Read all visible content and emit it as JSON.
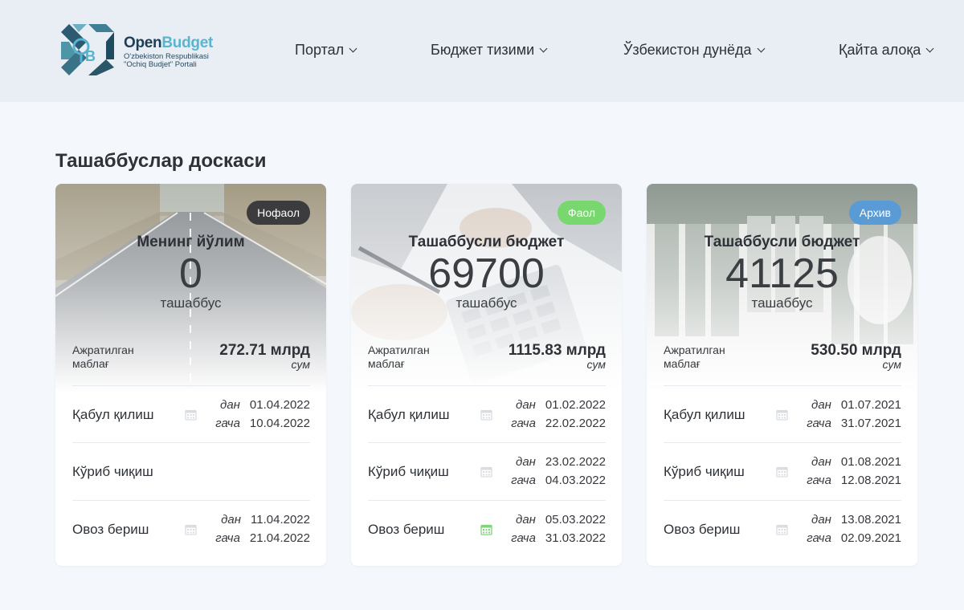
{
  "header": {
    "logo": {
      "title_bold": "Open",
      "title_light": "Budget",
      "subtitle": "O'zbekiston Respublikasi \"Ochiq Budjet\" Portali"
    },
    "nav": [
      {
        "label": "Портал"
      },
      {
        "label": "Бюджет тизими"
      },
      {
        "label": "Ўзбекистон дунёда"
      },
      {
        "label": "Қайта алоқа"
      }
    ]
  },
  "page": {
    "title": "Ташаббуслар доскаси"
  },
  "labels": {
    "from": "дан",
    "to": "гача",
    "allocated": "Ажратилган маблағ",
    "currency": "сум"
  },
  "cards": [
    {
      "badge": "Нофаол",
      "badge_color": "#3c3c3e",
      "title": "Менинг йўлим",
      "count": "0",
      "unit": "ташаббус",
      "amount": "272.71 млрд",
      "rows": [
        {
          "label": "Қабул қилиш",
          "from": "01.04.2022",
          "to": "10.04.2022",
          "active": false
        },
        {
          "label": "Кўриб чиқиш",
          "from": "",
          "to": "",
          "active": false
        },
        {
          "label": "Овоз бериш",
          "from": "11.04.2022",
          "to": "21.04.2022",
          "active": false
        }
      ]
    },
    {
      "badge": "Фаол",
      "badge_color": "#78d86f",
      "title": "Ташаббусли бюджет",
      "count": "69700",
      "unit": "ташаббус",
      "amount": "1115.83 млрд",
      "rows": [
        {
          "label": "Қабул қилиш",
          "from": "01.02.2022",
          "to": "22.02.2022",
          "active": false
        },
        {
          "label": "Кўриб чиқиш",
          "from": "23.02.2022",
          "to": "04.03.2022",
          "active": false
        },
        {
          "label": "Овоз бериш",
          "from": "05.03.2022",
          "to": "31.03.2022",
          "active": true
        }
      ]
    },
    {
      "badge": "Архив",
      "badge_color": "#5b9bd5",
      "title": "Ташаббусли бюджет",
      "count": "41125",
      "unit": "ташаббус",
      "amount": "530.50 млрд",
      "rows": [
        {
          "label": "Қабул қилиш",
          "from": "01.07.2021",
          "to": "31.07.2021",
          "active": false
        },
        {
          "label": "Кўриб чиқиш",
          "from": "01.08.2021",
          "to": "12.08.2021",
          "active": false
        },
        {
          "label": "Овоз бериш",
          "from": "13.08.2021",
          "to": "02.09.2021",
          "active": false
        }
      ]
    }
  ],
  "colors": {
    "calendar_inactive": "#d9dde2",
    "calendar_active": "#7fd67a",
    "header_bg": "#e8eef3",
    "page_bg": "#f4f7fb"
  }
}
